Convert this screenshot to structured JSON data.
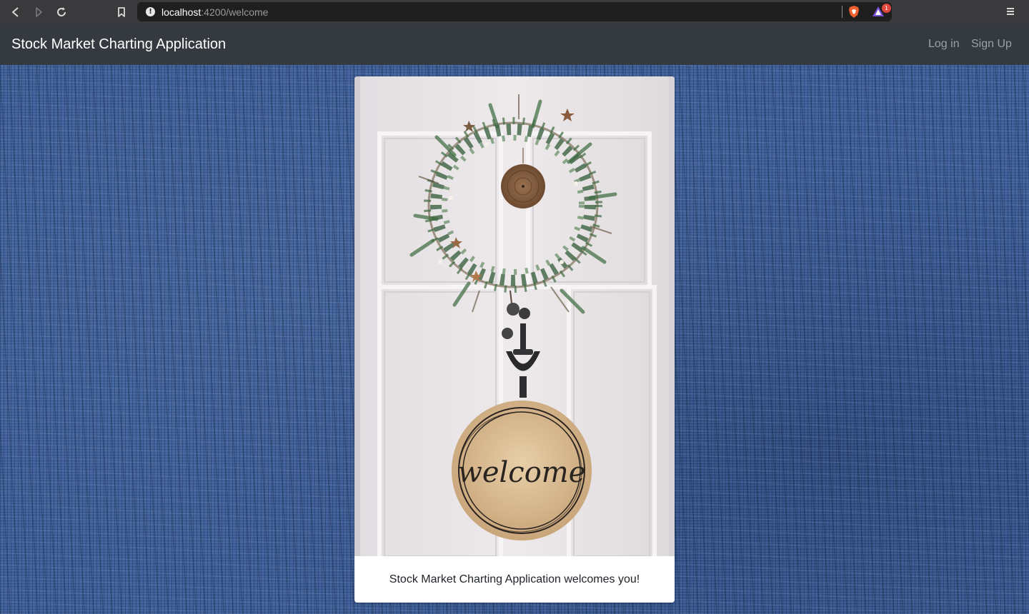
{
  "browser": {
    "url_host": "localhost",
    "url_rest": ":4200/welcome",
    "rewards_badge": "1",
    "icons": [
      "back-icon",
      "forward-icon",
      "reload-icon",
      "bookmark-icon",
      "site-info-icon",
      "brave-shield-icon",
      "brave-rewards-icon",
      "menu-icon"
    ]
  },
  "navbar": {
    "brand": "Stock Market Charting Application",
    "login_label": "Log in",
    "signup_label": "Sign Up"
  },
  "card": {
    "image_sign_text": "welcome",
    "caption": "Stock Market Charting Application welcomes you!"
  },
  "colors": {
    "navbar_bg": "#343a40",
    "page_bg": "#3d5d96",
    "card_bg": "#ffffff"
  }
}
